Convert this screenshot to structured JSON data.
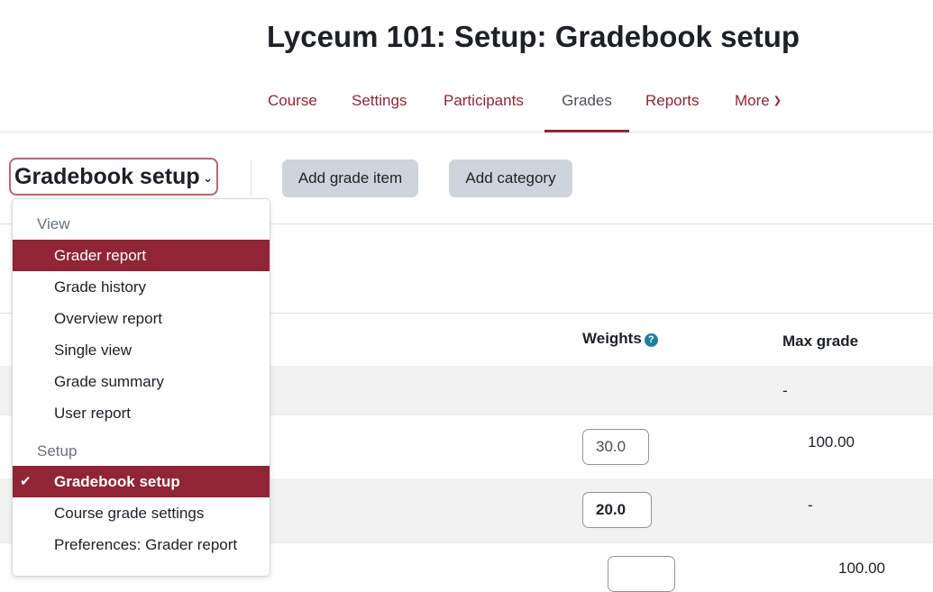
{
  "page": {
    "title": "Lyceum 101: Setup: Gradebook setup"
  },
  "nav": {
    "tabs": [
      {
        "label": "Course"
      },
      {
        "label": "Settings"
      },
      {
        "label": "Participants"
      },
      {
        "label": "Grades",
        "active": true
      },
      {
        "label": "Reports"
      },
      {
        "label": "More"
      }
    ]
  },
  "toolbar": {
    "selector_label": "Gradebook setup",
    "add_grade_item": "Add grade item",
    "add_category": "Add category"
  },
  "table": {
    "headers": {
      "weights": "Weights",
      "max_grade": "Max grade"
    },
    "rows": [
      {
        "weight": "",
        "max_grade": "-"
      },
      {
        "weight": "30.0",
        "max_grade": "100.00"
      },
      {
        "weight": "20.0",
        "max_grade": "-"
      },
      {
        "weight": "",
        "max_grade": "100.00"
      }
    ]
  },
  "dropdown": {
    "sections": [
      {
        "header": "View",
        "items": [
          {
            "label": "Grader report"
          },
          {
            "label": "Grade history"
          },
          {
            "label": "Overview report"
          },
          {
            "label": "Single view"
          },
          {
            "label": "Grade summary"
          },
          {
            "label": "User report"
          }
        ]
      },
      {
        "header": "Setup",
        "items": [
          {
            "label": "Gradebook setup"
          },
          {
            "label": "Course grade settings"
          },
          {
            "label": "Preferences: Grader report"
          }
        ]
      }
    ]
  },
  "colors": {
    "brand": "#8f2535",
    "help": "#1f7e9a",
    "button_bg": "#ced4da",
    "row_shade": "#f2f2f2"
  },
  "icons": {
    "more_chevron": "chevron-down-icon",
    "selector_chevron": "chevron-down-icon",
    "help": "question-circle-icon",
    "check": "check-icon"
  }
}
